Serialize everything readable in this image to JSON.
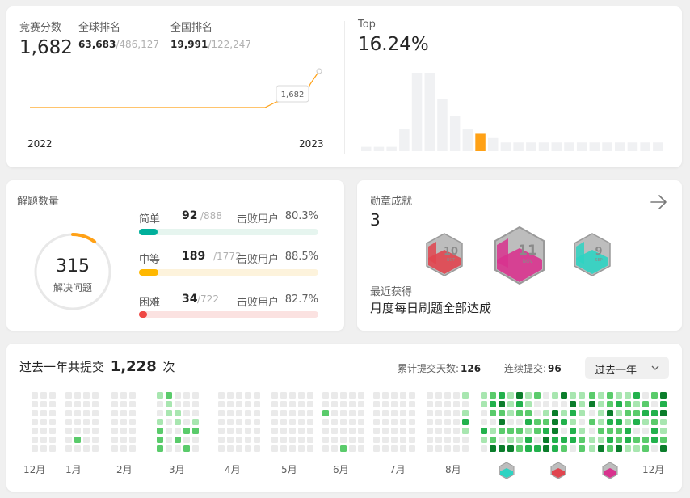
{
  "contest": {
    "rating_label": "竞赛分数",
    "rating": "1,682",
    "global_label": "全球排名",
    "global_rank": "63,683",
    "global_total": "/486,127",
    "national_label": "全国排名",
    "national_rank": "19,991",
    "national_total": "/122,247",
    "chart_tooltip": "1,682",
    "year_start": "2022",
    "year_end": "2023",
    "top_label": "Top",
    "top_value": "16.24%",
    "histogram": [
      1,
      1,
      1,
      5,
      18,
      18,
      12,
      8,
      5,
      4,
      3,
      2,
      2,
      2,
      2,
      2,
      2,
      2,
      2,
      2,
      2,
      2,
      2,
      2
    ],
    "histogram_highlight": 9
  },
  "solved": {
    "title": "解题数量",
    "total": "315",
    "total_label": "解决问题",
    "beat_label": "击败用户",
    "levels": [
      {
        "name": "简单",
        "count": "92",
        "total": "/888",
        "beat": "80.3%",
        "color": "#00af9b",
        "track": "#e6f5ef",
        "fill_ratio": 0.104
      },
      {
        "name": "中等",
        "count": "189",
        "total": "/1772",
        "beat": "88.5%",
        "color": "#ffb800",
        "track": "#fdf3dc",
        "fill_ratio": 0.107
      },
      {
        "name": "困难",
        "count": "34",
        "total": "/722",
        "beat": "82.7%",
        "color": "#ef4743",
        "track": "#fbe2e1",
        "fill_ratio": 0.047
      }
    ]
  },
  "badges": {
    "title": "勋章成就",
    "count": "3",
    "recent_label": "最近获得",
    "recent_name": "月度每日刷题全部达成",
    "items": [
      {
        "name": "10 OCT",
        "num": "10",
        "mon": "OCT",
        "color": "#e0454f"
      },
      {
        "name": "11 NOV",
        "num": "11",
        "mon": "NOV",
        "color": "#d8338e"
      },
      {
        "name": "9 SEP",
        "num": "9",
        "mon": "SEP",
        "color": "#2ed3c2"
      }
    ]
  },
  "submissions": {
    "prefix": "过去一年共提交",
    "count": "1,228",
    "suffix": "次",
    "days_label": "累计提交天数:",
    "days": "126",
    "streak_label": "连续提交:",
    "streak": "96",
    "range": "过去一年",
    "months": [
      "12月",
      "1月",
      "2月",
      "3月",
      "4月",
      "5月",
      "6月",
      "7月",
      "8月",
      "12月"
    ]
  }
}
